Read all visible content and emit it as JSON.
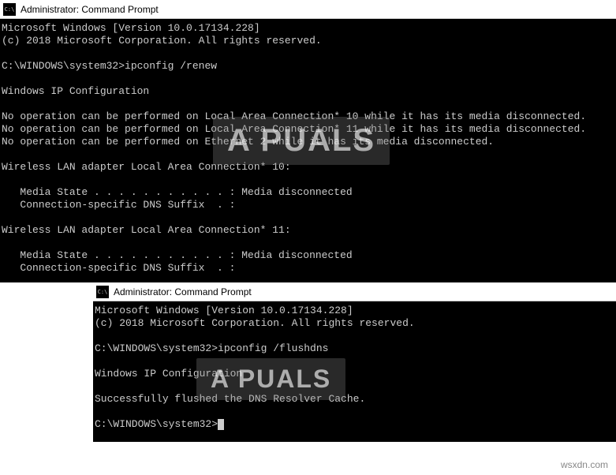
{
  "window1": {
    "title": "Administrator: Command Prompt",
    "lines": {
      "version": "Microsoft Windows [Version 10.0.17134.228]",
      "copyright": "(c) 2018 Microsoft Corporation. All rights reserved.",
      "prompt1": "C:\\WINDOWS\\system32>ipconfig /renew",
      "heading": "Windows IP Configuration",
      "noop1": "No operation can be performed on Local Area Connection* 10 while it has its media disconnected.",
      "noop2": "No operation can be performed on Local Area Connection* 11 while it has its media disconnected.",
      "noop3": "No operation can be performed on Ethernet 2 while it has its media disconnected.",
      "adapter1_title": "Wireless LAN adapter Local Area Connection* 10:",
      "adapter1_media": "   Media State . . . . . . . . . . . : Media disconnected",
      "adapter1_dns": "   Connection-specific DNS Suffix  . :",
      "adapter2_title": "Wireless LAN adapter Local Area Connection* 11:",
      "adapter2_media": "   Media State . . . . . . . . . . . : Media disconnected",
      "adapter2_dns": "   Connection-specific DNS Suffix  . :"
    }
  },
  "window2": {
    "title": "Administrator: Command Prompt",
    "lines": {
      "version": "Microsoft Windows [Version 10.0.17134.228]",
      "copyright": "(c) 2018 Microsoft Corporation. All rights reserved.",
      "prompt1": "C:\\WINDOWS\\system32>ipconfig /flushdns",
      "heading": "Windows IP Configuration",
      "success": "Successfully flushed the DNS Resolver Cache.",
      "prompt2": "C:\\WINDOWS\\system32>"
    }
  },
  "watermark_text": "A PUALS",
  "footer_url": "wsxdn.com"
}
